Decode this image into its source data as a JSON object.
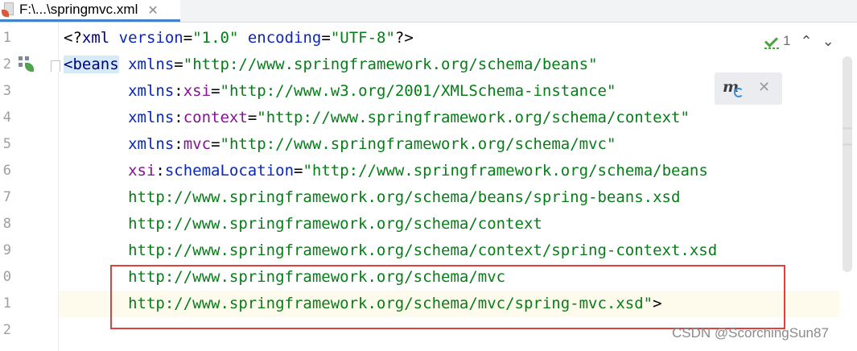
{
  "tab": {
    "title": "F:\\...\\springmvc.xml",
    "close_glyph": "✕",
    "file_icon": "xml-file-icon"
  },
  "gutter": {
    "line_numbers": [
      "1",
      "2",
      "3",
      "4",
      "5",
      "6",
      "7",
      "8",
      "9",
      "0",
      "1",
      "2"
    ]
  },
  "editor": {
    "lines": [
      [
        {
          "t": "plain",
          "v": "<?"
        },
        {
          "t": "tag",
          "v": "xml"
        },
        {
          "t": "plain",
          "v": " "
        },
        {
          "t": "attr",
          "v": "version"
        },
        {
          "t": "plain",
          "v": "="
        },
        {
          "t": "val",
          "v": "\"1.0\""
        },
        {
          "t": "plain",
          "v": " "
        },
        {
          "t": "attr",
          "v": "encoding"
        },
        {
          "t": "plain",
          "v": "="
        },
        {
          "t": "val",
          "v": "\"UTF-8\""
        },
        {
          "t": "plain",
          "v": "?>"
        }
      ],
      [
        {
          "t": "taghl",
          "v": "<beans"
        },
        {
          "t": "plain",
          "v": " "
        },
        {
          "t": "attr",
          "v": "xmlns"
        },
        {
          "t": "plain",
          "v": "="
        },
        {
          "t": "val",
          "v": "\"http://www.springframework.org/schema/beans\""
        }
      ],
      [
        {
          "t": "plain",
          "v": "       "
        },
        {
          "t": "attr",
          "v": "xmlns"
        },
        {
          "t": "plain",
          "v": ":"
        },
        {
          "t": "ns",
          "v": "xsi"
        },
        {
          "t": "plain",
          "v": "="
        },
        {
          "t": "val",
          "v": "\"http://www.w3.org/2001/XMLSchema-instance\""
        }
      ],
      [
        {
          "t": "plain",
          "v": "       "
        },
        {
          "t": "attr",
          "v": "xmlns"
        },
        {
          "t": "plain",
          "v": ":"
        },
        {
          "t": "ns",
          "v": "context"
        },
        {
          "t": "plain",
          "v": "="
        },
        {
          "t": "val",
          "v": "\"http://www.springframework.org/schema/context\""
        }
      ],
      [
        {
          "t": "plain",
          "v": "       "
        },
        {
          "t": "attr",
          "v": "xmlns"
        },
        {
          "t": "plain",
          "v": ":"
        },
        {
          "t": "ns",
          "v": "mvc"
        },
        {
          "t": "plain",
          "v": "="
        },
        {
          "t": "val",
          "v": "\"http://www.springframework.org/schema/mvc\""
        }
      ],
      [
        {
          "t": "plain",
          "v": "       "
        },
        {
          "t": "ns",
          "v": "xsi"
        },
        {
          "t": "plain",
          "v": ":"
        },
        {
          "t": "attr",
          "v": "schemaLocation"
        },
        {
          "t": "plain",
          "v": "="
        },
        {
          "t": "val",
          "v": "\"http://www.springframework.org/schema/beans"
        }
      ],
      [
        {
          "t": "plain",
          "v": "       "
        },
        {
          "t": "val",
          "v": "http://www.springframework.org/schema/beans/spring-beans.xsd"
        }
      ],
      [
        {
          "t": "plain",
          "v": "       "
        },
        {
          "t": "val",
          "v": "http://www.springframework.org/schema/context"
        }
      ],
      [
        {
          "t": "plain",
          "v": "       "
        },
        {
          "t": "val",
          "v": "http://www.springframework.org/schema/context/spring-context.xsd"
        }
      ],
      [
        {
          "t": "plain",
          "v": "       "
        },
        {
          "t": "val",
          "v": "http://www.springframework.org/schema/mvc"
        }
      ],
      [
        {
          "t": "plain",
          "v": "       "
        },
        {
          "t": "val",
          "v": "http://www.springframework.org/schema/mvc/spring-mvc.xsd\""
        },
        {
          "t": "plain",
          "v": ">"
        }
      ],
      []
    ],
    "current_line_index": 10
  },
  "inspection": {
    "count": "1",
    "up_glyph": "⌃",
    "down_glyph": "⌄",
    "icon": "inspection-check-icon"
  },
  "maven_popup": {
    "icon": "maven-reload-icon",
    "close_glyph": "✕"
  },
  "watermark": "CSDN @ScorchingSun87",
  "colors": {
    "tag": "#000080",
    "attr": "#0a27b6",
    "namespace": "#871094",
    "value": "#067d17",
    "current_line": "#fefbec",
    "annotation": "#e0413c",
    "tab_underline": "#4083c9"
  }
}
